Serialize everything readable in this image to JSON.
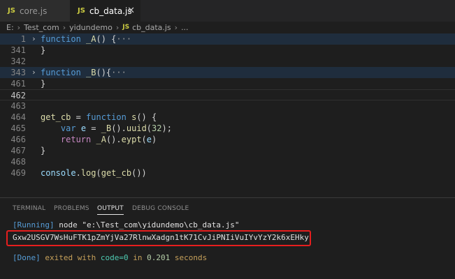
{
  "tabs": [
    {
      "icon": "JS",
      "label": "core.js"
    },
    {
      "icon": "JS",
      "label": "cb_data.js",
      "close": "✕"
    }
  ],
  "breadcrumb": {
    "items": [
      "E:",
      "Test_com",
      "yidundemo"
    ],
    "file_icon": "JS",
    "file": "cb_data.js",
    "tail": "..."
  },
  "editor": {
    "lines": [
      {
        "num": "1",
        "fold": "›",
        "segments": [
          {
            "t": "function",
            "c": "kw"
          },
          {
            "t": " ",
            "c": ""
          },
          {
            "t": "_A",
            "c": "fn"
          },
          {
            "t": "() {",
            "c": ""
          },
          {
            "t": "···",
            "c": "ell"
          }
        ]
      },
      {
        "num": "341",
        "segments": [
          {
            "t": "}",
            "c": ""
          }
        ]
      },
      {
        "num": "342",
        "segments": []
      },
      {
        "num": "343",
        "fold": "›",
        "segments": [
          {
            "t": "function",
            "c": "kw"
          },
          {
            "t": " ",
            "c": ""
          },
          {
            "t": "_B",
            "c": "fn"
          },
          {
            "t": "(){",
            "c": ""
          },
          {
            "t": "···",
            "c": "ell"
          }
        ]
      },
      {
        "num": "461",
        "segments": [
          {
            "t": "}",
            "c": ""
          }
        ]
      },
      {
        "num": "462",
        "segments": []
      },
      {
        "num": "463",
        "segments": []
      },
      {
        "num": "464",
        "segments": [
          {
            "t": "get_cb",
            "c": "fn"
          },
          {
            "t": " = ",
            "c": ""
          },
          {
            "t": "function",
            "c": "kw"
          },
          {
            "t": " ",
            "c": ""
          },
          {
            "t": "s",
            "c": "fn"
          },
          {
            "t": "() {",
            "c": ""
          }
        ]
      },
      {
        "num": "465",
        "segments": [
          {
            "t": "    ",
            "c": ""
          },
          {
            "t": "var",
            "c": "kw"
          },
          {
            "t": " ",
            "c": ""
          },
          {
            "t": "e",
            "c": "var"
          },
          {
            "t": " = ",
            "c": ""
          },
          {
            "t": "_B",
            "c": "fn"
          },
          {
            "t": "().",
            "c": ""
          },
          {
            "t": "uuid",
            "c": "fn"
          },
          {
            "t": "(",
            "c": ""
          },
          {
            "t": "32",
            "c": "num"
          },
          {
            "t": ");",
            "c": ""
          }
        ]
      },
      {
        "num": "466",
        "segments": [
          {
            "t": "    ",
            "c": ""
          },
          {
            "t": "return",
            "c": "kw2"
          },
          {
            "t": " ",
            "c": ""
          },
          {
            "t": "_A",
            "c": "fn"
          },
          {
            "t": "().",
            "c": ""
          },
          {
            "t": "eypt",
            "c": "fn"
          },
          {
            "t": "(",
            "c": ""
          },
          {
            "t": "e",
            "c": "var"
          },
          {
            "t": ")",
            "c": ""
          }
        ]
      },
      {
        "num": "467",
        "segments": [
          {
            "t": "}",
            "c": ""
          }
        ]
      },
      {
        "num": "468",
        "segments": []
      },
      {
        "num": "469",
        "segments": [
          {
            "t": "console",
            "c": "var"
          },
          {
            "t": ".",
            "c": ""
          },
          {
            "t": "log",
            "c": "fn"
          },
          {
            "t": "(",
            "c": ""
          },
          {
            "t": "get_cb",
            "c": "fn"
          },
          {
            "t": "())",
            "c": ""
          }
        ]
      }
    ]
  },
  "panel": {
    "tabs": [
      "TERMINAL",
      "PROBLEMS",
      "OUTPUT",
      "DEBUG CONSOLE"
    ],
    "active_tab": "OUTPUT",
    "running_tag": "[Running]",
    "running_cmd": " node \"e:\\Test_com\\yidundemo\\cb_data.js\"",
    "result": "Gxw2USGV7WsHuFTK1pZmYjVa27RlnwXadgn1tK71CvJiPNIiVuIYvYzY2k6xEHky",
    "done_tag": "[Done]",
    "done_a": " exited with ",
    "done_code": "code=0",
    "done_b": " in ",
    "done_time": "0.201",
    "done_c": " seconds"
  }
}
